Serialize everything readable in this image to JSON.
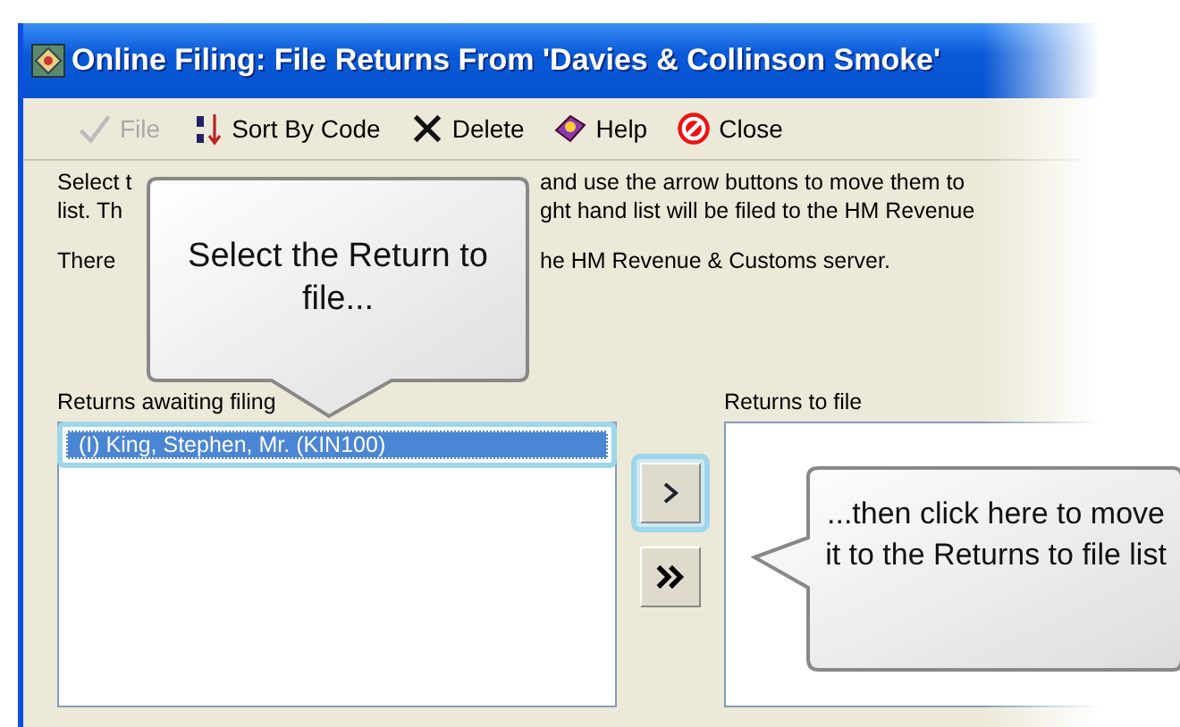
{
  "window": {
    "title": "Online Filing: File Returns From 'Davies & Collinson Smoke'"
  },
  "toolbar": [
    {
      "kind": "file",
      "label": "File",
      "disabled": true
    },
    {
      "kind": "sort",
      "label": "Sort By Code",
      "disabled": false
    },
    {
      "kind": "delete",
      "label": "Delete",
      "disabled": false
    },
    {
      "kind": "help",
      "label": "Help",
      "disabled": false
    },
    {
      "kind": "close",
      "label": "Close",
      "disabled": false
    }
  ],
  "instructions": [
    {
      "before": "Select t",
      "after": "and use the arrow buttons to move them to"
    },
    {
      "before": "list.  Th",
      "after": "ght hand list will be filed to the HM Revenue"
    },
    {
      "before": "There",
      "after": "he HM Revenue & Customs server."
    }
  ],
  "awaiting_list": {
    "label": "Returns awaiting filing",
    "items": [
      {
        "text": "(I) King, Stephen, Mr. (KIN100)",
        "selected": true
      }
    ]
  },
  "to_file_list": {
    "label": "Returns to file"
  },
  "callouts": [
    {
      "kind": "down",
      "text": "Select the Return to file..."
    },
    {
      "kind": "left",
      "text": "...then click here to move it to the Returns to file list"
    }
  ]
}
